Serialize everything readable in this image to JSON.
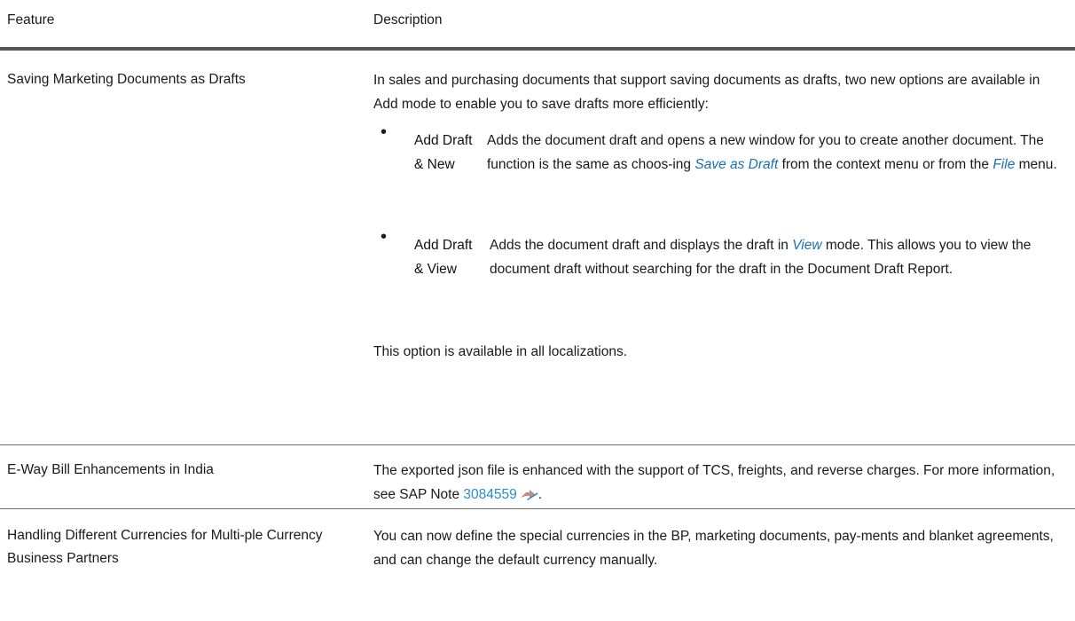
{
  "table": {
    "headers": {
      "feature": "Feature",
      "description": "Description"
    },
    "rows": [
      {
        "feature": "Saving Marketing Documents as Drafts",
        "intro": "In sales and purchasing documents that support saving documents as drafts, two new options are available in Add mode to enable you to save drafts more efficiently:",
        "options": [
          {
            "term": "Add Draft & New",
            "desc_1": "Adds the document draft and opens a new window for you to create another document. The function is the same as choos-ing ",
            "ui_1": "Save as Draft",
            "desc_2": " from the context menu or from the ",
            "ui_2": "File",
            "desc_3": " menu."
          },
          {
            "term": "Add Draft & View",
            "desc_1": "Adds the document draft and displays the draft in ",
            "ui_1": "View",
            "desc_2": " mode. This allows you to view the document draft without searching for the draft in the Document Draft Report."
          }
        ],
        "note": "This option is available in all localizations."
      },
      {
        "feature": "E-Way Bill Enhancements in India",
        "desc_1": "The exported json file is enhanced with the support of TCS, freights, and reverse charges. For more information, see SAP Note ",
        "link": "3084559",
        "desc_2": "."
      },
      {
        "feature": "Handling Different Currencies for Multi-ple Currency Business Partners",
        "desc": "You can now define the special currencies in the BP, marketing documents, pay-ments and blanket agreements, and can change the default currency manually."
      }
    ]
  },
  "icons": {
    "external_link": "external-link-icon",
    "bullet": "•"
  },
  "colors": {
    "link": "#2a8ad2",
    "ui_term": "#1a6fb0",
    "header_rule": "#555555"
  }
}
